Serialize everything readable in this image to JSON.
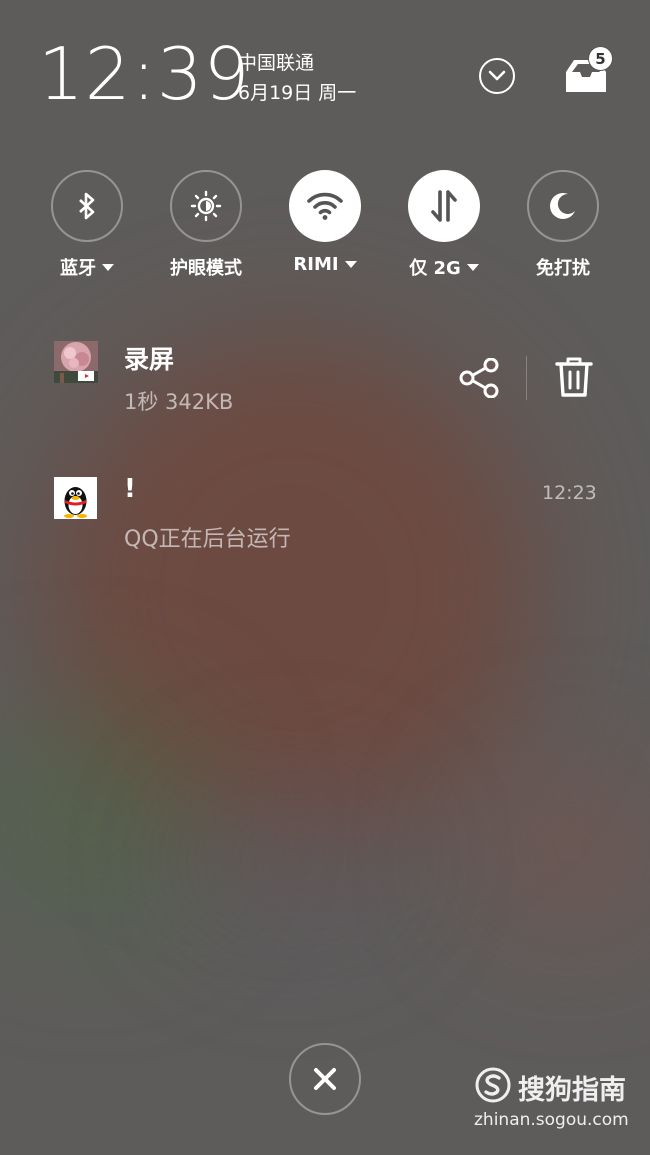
{
  "status": {
    "time": "12:39",
    "carrier": "中国联通",
    "date": "6月19日 周一",
    "notification_count": "5"
  },
  "quick_settings": [
    {
      "label": "蓝牙",
      "icon": "bluetooth-icon",
      "active": false,
      "has_menu": true
    },
    {
      "label": "护眼模式",
      "icon": "eye-care-icon",
      "active": false,
      "has_menu": false
    },
    {
      "label": "RIMI",
      "icon": "wifi-icon",
      "active": true,
      "has_menu": true
    },
    {
      "label": "仅 2G",
      "icon": "mobile-data-icon",
      "active": true,
      "has_menu": true
    },
    {
      "label": "免打扰",
      "icon": "moon-icon",
      "active": false,
      "has_menu": false
    }
  ],
  "notifications": [
    {
      "app": "screen-recorder",
      "title": "录屏",
      "subtitle": "1秒  342KB",
      "actions": [
        "share",
        "delete"
      ]
    },
    {
      "app": "qq",
      "title": "!",
      "subtitle": "QQ正在后台运行",
      "time": "12:23"
    }
  ],
  "watermark": {
    "name": "搜狗指南",
    "url": "zhinan.sogou.com"
  },
  "colors": {
    "background": "#5e5c5b",
    "accent_text": "#ffffff"
  }
}
